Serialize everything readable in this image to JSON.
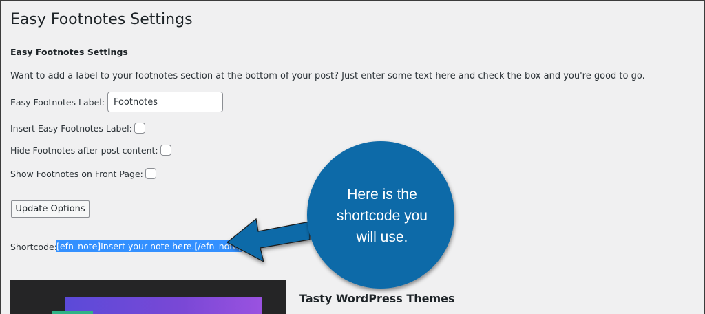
{
  "page": {
    "title": "Easy Footnotes Settings",
    "section_title": "Easy Footnotes Settings",
    "intro": "Want to add a label to your footnotes section at the bottom of your post? Just enter some text here and check the box and you're good to go."
  },
  "fields": {
    "label_caption": "Easy Footnotes Label:",
    "label_value": "Footnotes",
    "insert_label_caption": "Insert Easy Footnotes Label:",
    "hide_after_caption": "Hide Footnotes after post content:",
    "show_front_caption": "Show Footnotes on Front Page:"
  },
  "checkboxes": {
    "insert_label_checked": false,
    "hide_after_checked": false,
    "show_front_checked": false
  },
  "actions": {
    "update_label": "Update Options"
  },
  "shortcode": {
    "caption": "Shortcode:",
    "value": "[efn_note]Insert your note here.[/efn_note]"
  },
  "callout": {
    "lines": [
      "Here is the",
      "shortcode you",
      "will use."
    ],
    "color": "#0e6aa8"
  },
  "theme_card": {
    "title": "Tasty WordPress Themes"
  }
}
